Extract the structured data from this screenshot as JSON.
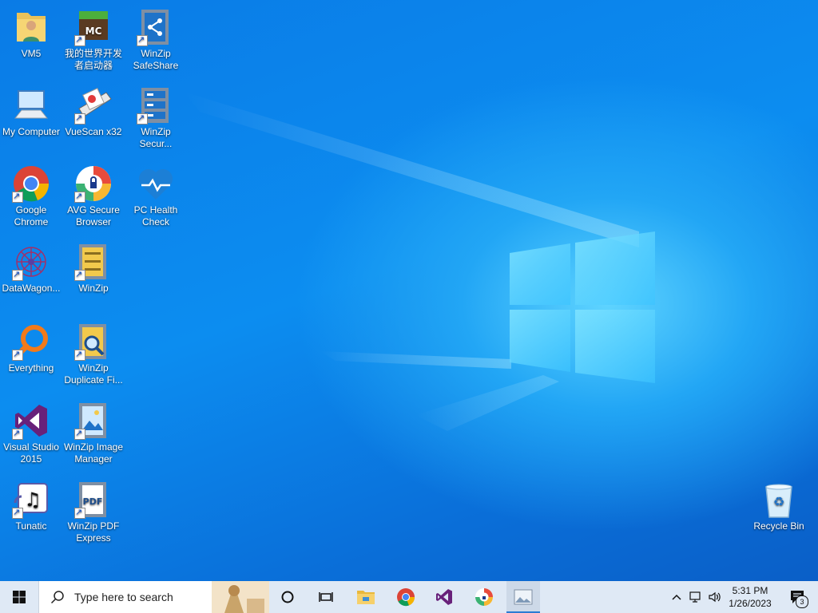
{
  "desktop": {
    "icons": [
      {
        "label": "VM5",
        "icon": "folder-user-icon"
      },
      {
        "label": "我的世界开发者启动器",
        "icon": "minecraft-icon"
      },
      {
        "label": "WinZip SafeShare",
        "icon": "winzip-safeshare-icon"
      },
      {
        "label": "My Computer",
        "icon": "computer-icon"
      },
      {
        "label": "VueScan x32",
        "icon": "scanner-icon"
      },
      {
        "label": "WinZip Secur...",
        "icon": "winzip-secure-icon"
      },
      {
        "label": "Google Chrome",
        "icon": "chrome-icon"
      },
      {
        "label": "AVG Secure Browser",
        "icon": "avg-browser-icon"
      },
      {
        "label": "PC Health Check",
        "icon": "health-check-icon"
      },
      {
        "label": "DataWagon...",
        "icon": "datawagon-icon"
      },
      {
        "label": "WinZip",
        "icon": "winzip-icon"
      },
      {
        "label": "Everything",
        "icon": "everything-search-icon"
      },
      {
        "label": "WinZip Duplicate Fi...",
        "icon": "winzip-duplicate-icon"
      },
      {
        "label": "Visual Studio 2015",
        "icon": "visual-studio-icon"
      },
      {
        "label": "WinZip Image Manager",
        "icon": "winzip-image-icon"
      },
      {
        "label": "Tunatic",
        "icon": "tunatic-icon"
      },
      {
        "label": "WinZip PDF Express",
        "icon": "winzip-pdf-icon"
      },
      {
        "label": "Recycle Bin",
        "icon": "recycle-bin-icon"
      }
    ]
  },
  "taskbar": {
    "search_placeholder": "Type here to search",
    "time": "5:31 PM",
    "date": "1/26/2023",
    "notification_count": "3",
    "pinned": [
      "task-view",
      "file-explorer",
      "chrome",
      "visual-studio",
      "avg-browser",
      "image-manager"
    ]
  },
  "colors": {
    "desktop_blue": "#0c8df0",
    "taskbar_bg": "#dfe9f5",
    "accent": "#2b7cd3"
  }
}
